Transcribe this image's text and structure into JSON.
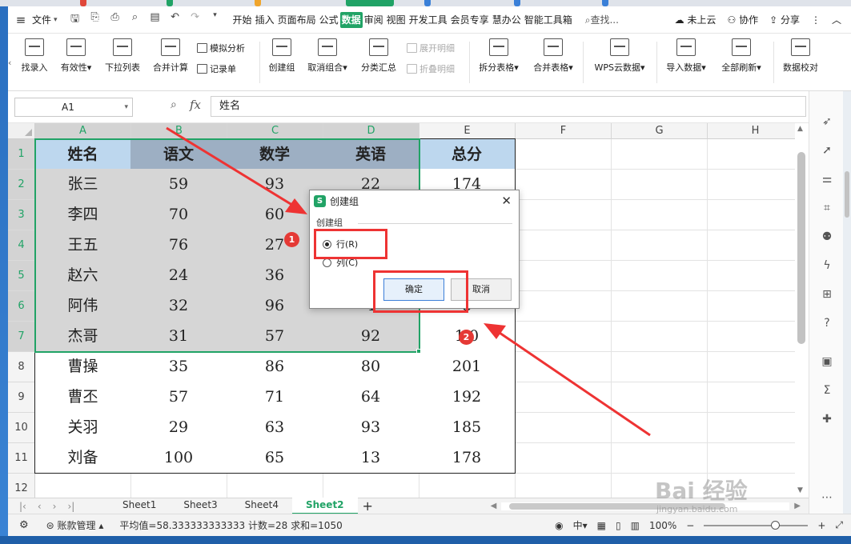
{
  "menubar": {
    "file_label": "文件",
    "menus": [
      "开始",
      "插入",
      "页面布局",
      "公式",
      "数据",
      "审阅",
      "视图",
      "开发工具",
      "会员专享",
      "慧办公",
      "智能工具箱"
    ],
    "active_menu": "数据",
    "search_placeholder": "查找...",
    "cloud_label": "未上云",
    "collab_label": "协作",
    "share_label": "分享"
  },
  "ribbon": {
    "find_entry": "找录入",
    "validity": "有效性",
    "dropdown_list": "下拉列表",
    "merge_calc": "合并计算",
    "simulate_analysis": "模拟分析",
    "record_sheet": "记录单",
    "create_group": "创建组",
    "ungroup": "取消组合",
    "subtotal": "分类汇总",
    "expand_detail": "展开明细",
    "collapse_detail": "折叠明细",
    "split_table": "拆分表格",
    "merge_table": "合并表格",
    "wps_cloud_data": "WPS云数据",
    "import_data": "导入数据",
    "refresh_all": "全部刷新",
    "data_check": "数据校对"
  },
  "formula_bar": {
    "cell_ref": "A1",
    "fx": "fx",
    "content": "姓名"
  },
  "sheet": {
    "columns": [
      "A",
      "B",
      "C",
      "D",
      "E",
      "F",
      "G",
      "H"
    ],
    "rows": [
      "1",
      "2",
      "3",
      "4",
      "5",
      "6",
      "7",
      "8",
      "9",
      "10",
      "11",
      "12"
    ],
    "headers": [
      "姓名",
      "语文",
      "数学",
      "英语",
      "总分"
    ],
    "data": [
      [
        "张三",
        "59",
        "93",
        "22",
        "174"
      ],
      [
        "李四",
        "70",
        "60",
        "",
        ""
      ],
      [
        "王五",
        "76",
        "27",
        "",
        ""
      ],
      [
        "赵六",
        "24",
        "36",
        "",
        ""
      ],
      [
        "阿伟",
        "32",
        "96",
        "4",
        "8"
      ],
      [
        "杰哥",
        "31",
        "57",
        "92",
        "1 0"
      ],
      [
        "曹操",
        "35",
        "86",
        "80",
        "201"
      ],
      [
        "曹丕",
        "57",
        "71",
        "64",
        "192"
      ],
      [
        "关羽",
        "29",
        "63",
        "93",
        "185"
      ],
      [
        "刘备",
        "100",
        "65",
        "13",
        "178"
      ]
    ]
  },
  "dialog": {
    "title": "创建组",
    "group_label": "创建组",
    "option_row": "行(R)",
    "option_col": "列(C)",
    "selected": "row",
    "ok_label": "确定",
    "cancel_label": "取消"
  },
  "annotations": {
    "badge1": "1",
    "badge2": "2",
    "color": "#ee3333"
  },
  "sheet_tabs": {
    "tabs": [
      "Sheet1",
      "Sheet3",
      "Sheet4",
      "Sheet2"
    ],
    "active": "Sheet2"
  },
  "status": {
    "account": "账款管理",
    "stats": "平均值=58.333333333333  计数=28  求和=1050",
    "zoom": "100%"
  },
  "watermark": {
    "brand": "Bai 经验",
    "url": "jingyan.baidu.com"
  },
  "colors": {
    "accent": "#21a366",
    "header_blue": "#bdd7ee",
    "selection": "#21a366"
  }
}
